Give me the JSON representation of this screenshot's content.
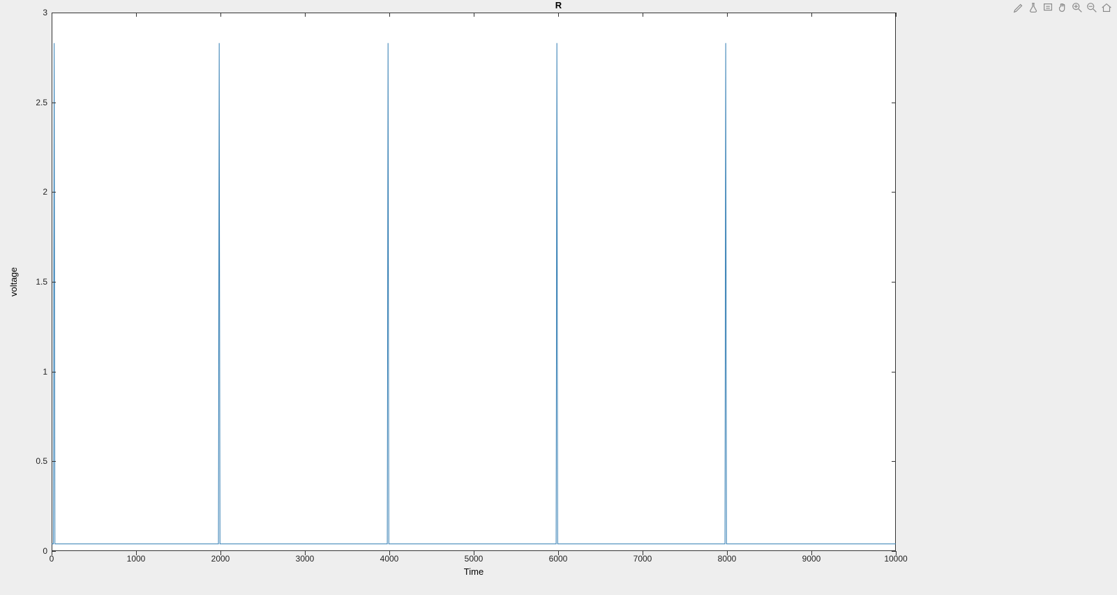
{
  "chart_data": {
    "type": "line",
    "title": "R",
    "xlabel": "Time",
    "ylabel": "voltage",
    "xlim": [
      0,
      10000
    ],
    "ylim": [
      0,
      3
    ],
    "xticks": [
      0,
      1000,
      2000,
      3000,
      4000,
      5000,
      6000,
      7000,
      8000,
      9000,
      10000
    ],
    "yticks": [
      0,
      0.5,
      1,
      1.5,
      2,
      2.5,
      3
    ],
    "series": [
      {
        "name": "R",
        "color": "#2f7bb2",
        "baseline": 0.04,
        "spikes": [
          {
            "x": 30,
            "y": 2.83
          },
          {
            "x": 1985,
            "y": 2.83
          },
          {
            "x": 3985,
            "y": 2.83
          },
          {
            "x": 5985,
            "y": 2.83
          },
          {
            "x": 7985,
            "y": 2.83
          }
        ]
      }
    ]
  },
  "toolbar": {
    "icons": [
      "brush",
      "color-picker",
      "data-tips",
      "pan",
      "zoom-in",
      "zoom-out",
      "home"
    ]
  }
}
